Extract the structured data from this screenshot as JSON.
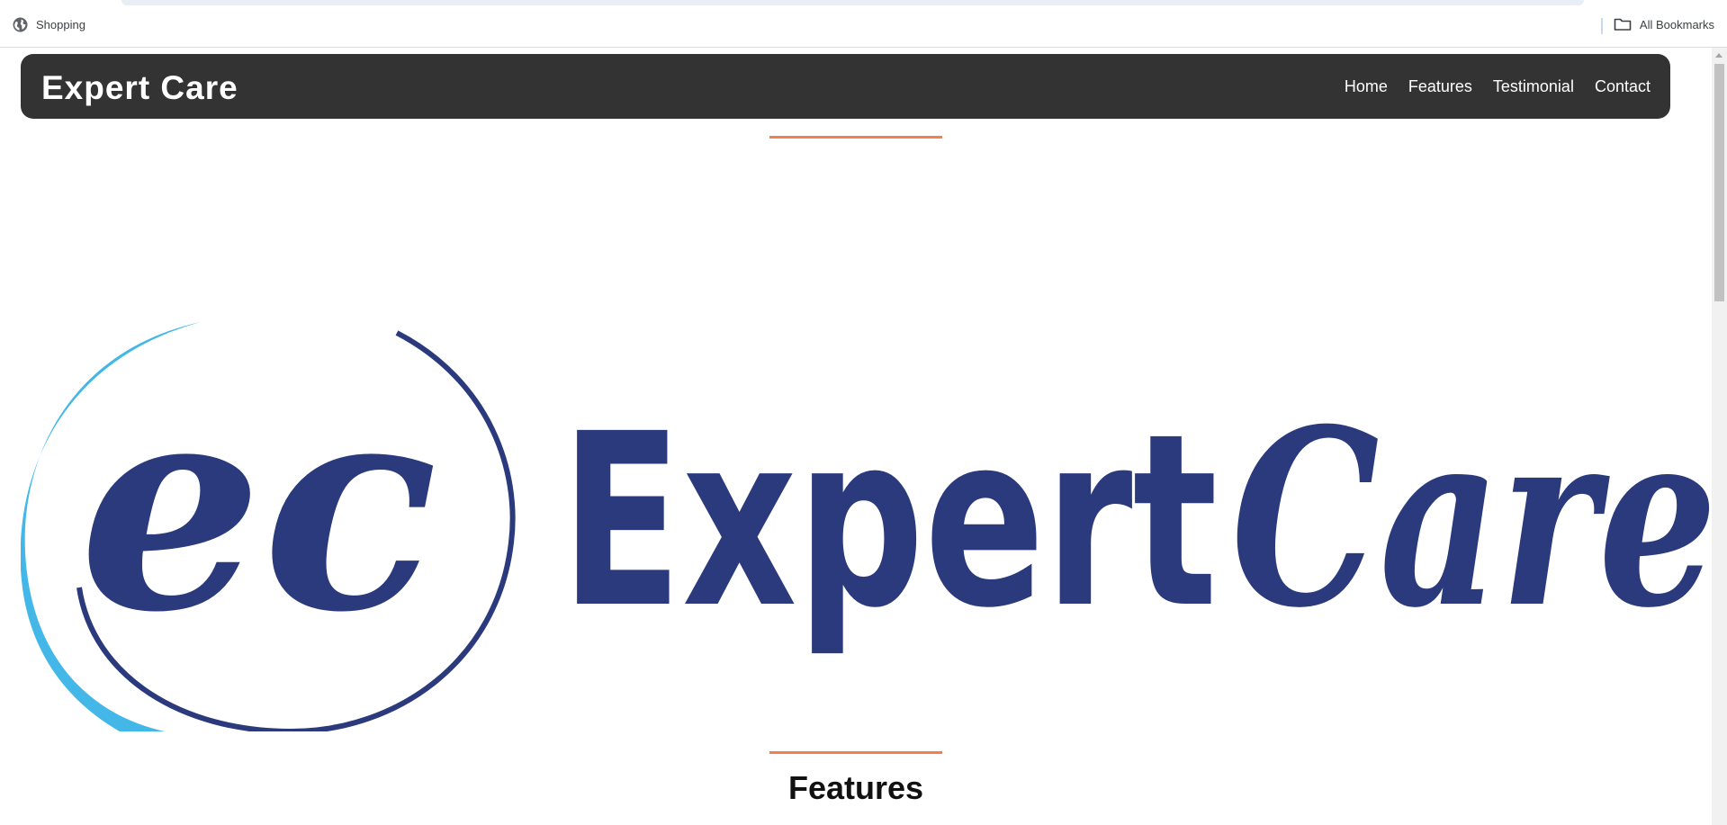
{
  "browser": {
    "bookmark_left": "Shopping",
    "bookmark_right": "All Bookmarks",
    "icons": [
      "globe-icon",
      "folder-icon"
    ]
  },
  "navbar": {
    "brand": "Expert Care",
    "links": [
      "Home",
      "Features",
      "Testimonial",
      "Contact"
    ],
    "background": "#333333"
  },
  "hero": {
    "logo_name": "ExpertCare",
    "logo_text_sans": "Expert",
    "logo_text_script": "Care",
    "logo_monogram": "ec",
    "logo_colors": {
      "navy": "#2b3a7d",
      "sky": "#42b7e8"
    }
  },
  "sections": {
    "features_title": "Features"
  },
  "accent_color": "#f08050"
}
